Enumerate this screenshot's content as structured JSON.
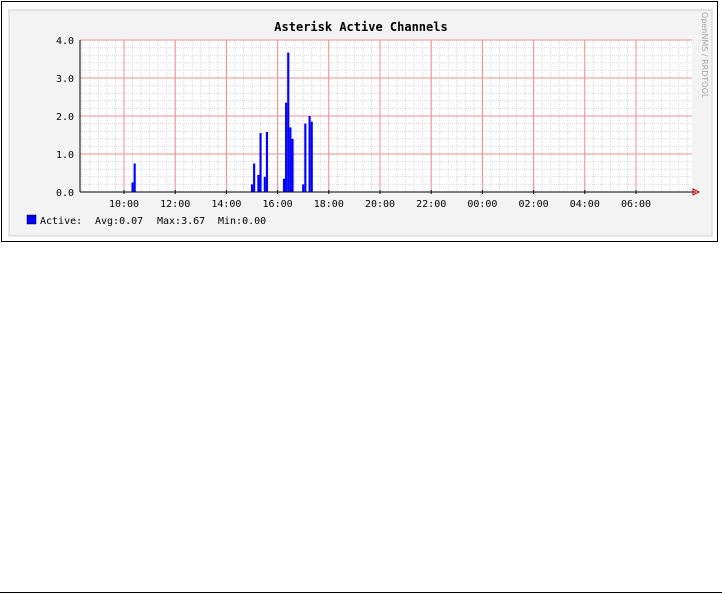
{
  "chart_data": {
    "type": "bar",
    "title": "Asterisk Active Channels",
    "watermark": "OpenNMS / RRDTOOL",
    "xlabel": "",
    "ylabel": "",
    "ylim": [
      0,
      4
    ],
    "y_ticks": [
      "0.0",
      "1.0",
      "2.0",
      "3.0",
      "4.0"
    ],
    "x_ticks": [
      "10:00",
      "12:00",
      "14:00",
      "16:00",
      "18:00",
      "20:00",
      "22:00",
      "00:00",
      "02:00",
      "04:00",
      "06:00"
    ],
    "grid": true,
    "series": [
      {
        "name": "Active",
        "color": "#0000ff",
        "x": [
          "10:20",
          "10:25",
          "15:00",
          "15:05",
          "15:15",
          "15:20",
          "15:30",
          "15:35",
          "16:15",
          "16:20",
          "16:25",
          "16:30",
          "16:35",
          "17:00",
          "17:05",
          "17:15",
          "17:20"
        ],
        "values": [
          0.25,
          0.75,
          0.2,
          0.75,
          0.45,
          1.55,
          0.4,
          1.58,
          0.35,
          2.35,
          3.67,
          1.7,
          1.4,
          0.2,
          1.8,
          2.0,
          1.85
        ]
      }
    ]
  },
  "legend": {
    "label": "Active:",
    "avg": "Avg:0.07",
    "max": "Max:3.67",
    "min": "Min:0.00",
    "color": "#0000ff"
  }
}
